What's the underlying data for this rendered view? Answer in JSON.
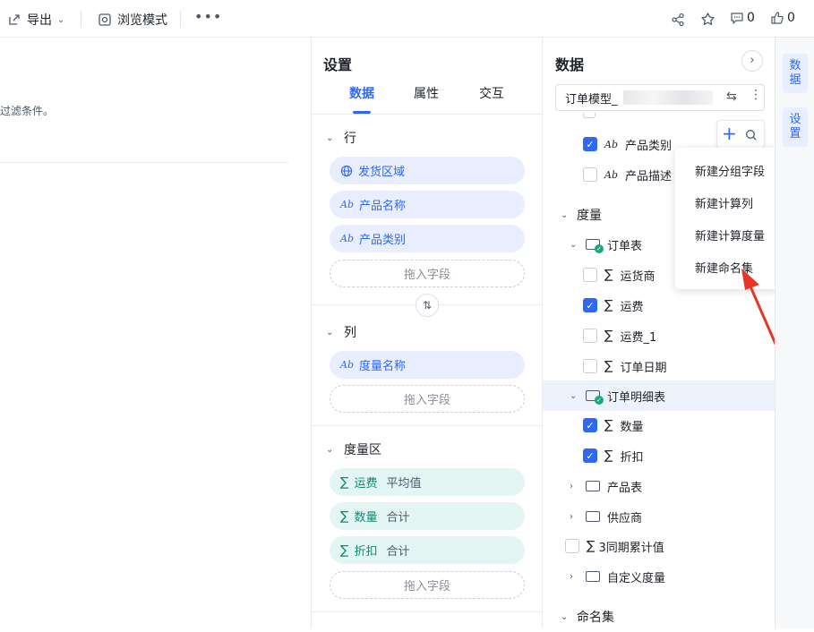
{
  "toolbar": {
    "export_label": "导出",
    "browse_label": "浏览模式",
    "comment_count": "0",
    "like_count": "0"
  },
  "left": {
    "filter_hint": "过滤条件。"
  },
  "settings": {
    "title": "设置",
    "tabs": [
      "数据",
      "属性",
      "交互"
    ],
    "rows_section": {
      "label": "行",
      "fields": [
        "发货区域",
        "产品名称",
        "产品类别"
      ],
      "drop": "拖入字段"
    },
    "cols_section": {
      "label": "列",
      "fields": [
        "度量名称"
      ],
      "drop": "拖入字段"
    },
    "measure_section": {
      "label": "度量区",
      "fields": [
        {
          "name": "运费",
          "agg": "平均值"
        },
        {
          "name": "数量",
          "agg": "合计"
        },
        {
          "name": "折扣",
          "agg": "合计"
        }
      ],
      "drop": "拖入字段"
    }
  },
  "data_panel": {
    "title": "数据",
    "model_name": "订单模型_",
    "dims": [
      {
        "label": "产品类别",
        "checked": true
      },
      {
        "label": "产品描述",
        "checked": false
      }
    ],
    "measure_group": "度量",
    "order_table": "订单表",
    "order_fields": [
      {
        "label": "运货商",
        "checked": false
      },
      {
        "label": "运费",
        "checked": true
      },
      {
        "label": "运费_1",
        "checked": false
      },
      {
        "label": "订单日期",
        "checked": false
      }
    ],
    "detail_table": "订单明细表",
    "detail_fields": [
      {
        "label": "数量",
        "checked": true
      },
      {
        "label": "折扣",
        "checked": true
      }
    ],
    "product_table": "产品表",
    "supplier_table": "供应商",
    "ytd_measure": "3同期累计值",
    "custom_measure": "自定义度量",
    "named_set": "命名集"
  },
  "menu": {
    "items": [
      "新建分组字段",
      "新建计算列",
      "新建计算度量",
      "新建命名集"
    ]
  },
  "rail": {
    "data_label": "数据",
    "settings_label": "设置"
  },
  "colors": {
    "accent": "#2e68f5",
    "measure_green": "#0e8a72",
    "arrow_red": "#e8352a"
  }
}
